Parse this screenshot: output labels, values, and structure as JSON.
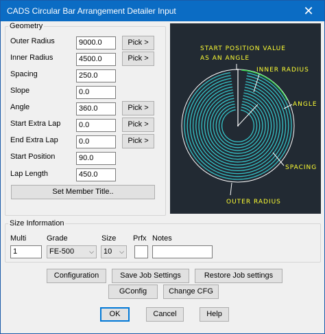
{
  "window": {
    "title": "CADS Circular Bar Arrangement Detailer Input",
    "close_glyph": "✕"
  },
  "geometry": {
    "legend": "Geometry",
    "fields": [
      {
        "label": "Outer Radius",
        "value": "9000.0",
        "pick": "Pick >"
      },
      {
        "label": "Inner Radius",
        "value": "4500.0",
        "pick": "Pick >"
      },
      {
        "label": "Spacing",
        "value": "250.0"
      },
      {
        "label": "Slope",
        "value": "0.0"
      },
      {
        "label": "Angle",
        "value": "360.0",
        "pick": "Pick >"
      },
      {
        "label": "Start Extra Lap",
        "value": "0.0",
        "pick": "Pick >"
      },
      {
        "label": "End Extra Lap",
        "value": "0.0",
        "pick": "Pick >"
      },
      {
        "label": "Start Position",
        "value": "90.0"
      },
      {
        "label": "Lap Length",
        "value": "450.0"
      }
    ],
    "set_member_title": "Set Member Title.."
  },
  "diagram": {
    "start_position_line1": "START POSITION VALUE",
    "start_position_line2": "AS AN ANGLE",
    "inner_radius": "INNER RADIUS",
    "angle": "ANGLE",
    "spacing": "SPACING",
    "outer_radius": "OUTER RADIUS",
    "colors": {
      "background": "#222a33",
      "bars": "#35c3c8",
      "labels": "#ffff33",
      "lines": "#ffffff",
      "arc": "#2ed34a"
    }
  },
  "size_info": {
    "legend": "Size Information",
    "multi_label": "Multi",
    "multi_value": "1",
    "grade_label": "Grade",
    "grade_value": "FE-500",
    "size_label": "Size",
    "size_value": "10",
    "prfx_label": "Prfx",
    "prfx_value": "",
    "notes_label": "Notes",
    "notes_value": ""
  },
  "buttons": {
    "configuration": "Configuration",
    "save_job": "Save Job Settings",
    "restore_job": "Restore Job settings",
    "gconfig": "GConfig",
    "change_cfg": "Change CFG",
    "ok": "OK",
    "cancel": "Cancel",
    "help": "Help"
  }
}
